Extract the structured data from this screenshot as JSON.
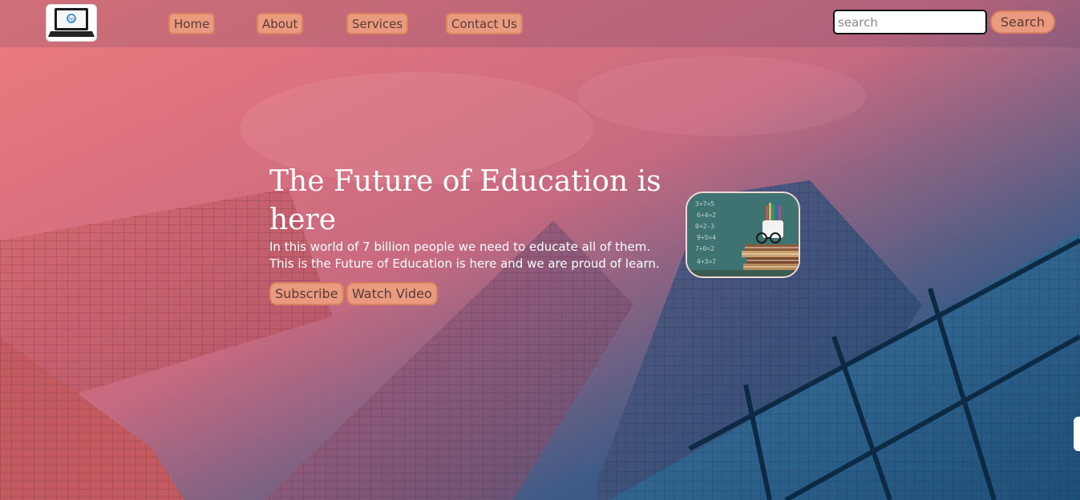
{
  "nav": {
    "logo_icon": "hp-laptop-logo",
    "links": [
      "Home",
      "About",
      "Services",
      "Contact Us"
    ]
  },
  "search": {
    "placeholder": "search",
    "button_label": "Search"
  },
  "hero": {
    "title": "The Future of Education is here",
    "text_line1": "In this world of 7 billion people we need to educate all of them.",
    "text_line2": "This is the Future of Education is here and we are proud of learn.",
    "subscribe_label": "Subscribe",
    "watch_label": "Watch Video",
    "image_icon": "books-and-pencils-image"
  },
  "colors": {
    "button_fill": "#e99a7f",
    "button_border": "#d9825f",
    "button_text": "#5a3a3a",
    "gradient_start": "#e8707a",
    "gradient_end": "#1f4a75"
  }
}
